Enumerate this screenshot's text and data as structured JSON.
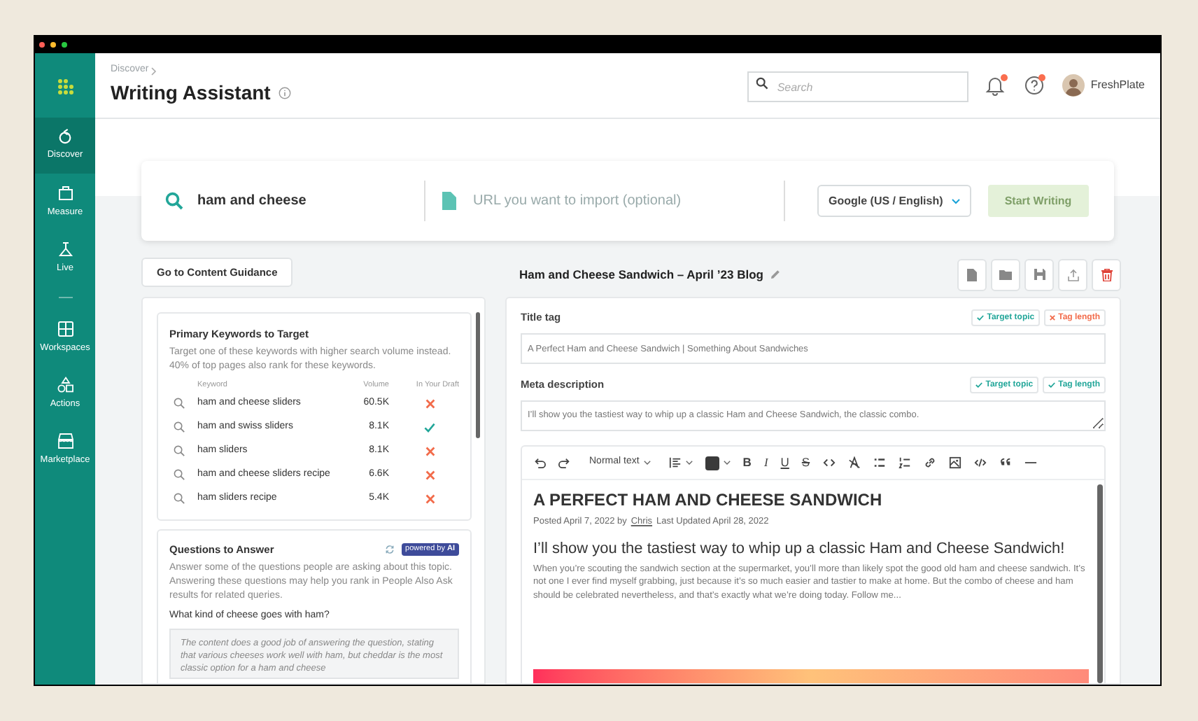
{
  "sidebar": {
    "items": [
      {
        "label": "Discover",
        "selected": true
      },
      {
        "label": "Measure",
        "selected": false
      },
      {
        "label": "Live",
        "selected": false
      },
      {
        "label": "Workspaces",
        "selected": false
      },
      {
        "label": "Actions",
        "selected": false
      },
      {
        "label": "Marketplace",
        "selected": false
      }
    ]
  },
  "header": {
    "breadcrumb": "Discover",
    "title": "Writing Assistant",
    "search": {
      "placeholder": "Search"
    },
    "notifications_unread": true,
    "help_unread": true,
    "user": "FreshPlate"
  },
  "start": {
    "keyword": "ham and cheese",
    "url_placeholder": "URL you want to import (optional)",
    "engine": "Google (US / English)",
    "button": {
      "label": "Start Writing",
      "disabled": true
    }
  },
  "guidance_button": "Go to Content Guidance",
  "keywords": {
    "title": "Primary Keywords to Target",
    "description": "Target one of these keywords with higher search volume instead. 40% of top pages also rank for these keywords.",
    "columns": [
      "Keyword",
      "Volume",
      "In Your Draft"
    ],
    "rows": [
      {
        "keyword": "ham and cheese sliders",
        "volume": "60.5K",
        "in_draft": false
      },
      {
        "keyword": "ham and swiss sliders",
        "volume": "8.1K",
        "in_draft": true
      },
      {
        "keyword": "ham sliders",
        "volume": "8.1K",
        "in_draft": false
      },
      {
        "keyword": "ham and cheese sliders recipe",
        "volume": "6.6K",
        "in_draft": false
      },
      {
        "keyword": "ham sliders recipe",
        "volume": "5.4K",
        "in_draft": false
      }
    ]
  },
  "questions": {
    "title": "Questions to Answer",
    "badge": "powered by **AI**",
    "description": "Answer some of the questions people are asking about this topic. Answering these questions may help you rank in People Also Ask results for related queries.",
    "question": "What kind of cheese goes with ham?",
    "answer": "The content does a good job of answering the question, stating that various cheeses work well with ham, but cheddar is the most classic option for a ham and cheese"
  },
  "document": {
    "title": "Ham and Cheese Sandwich – April ’23 Blog",
    "fields": [
      {
        "label": "Title tag",
        "kind": "input",
        "value": "A Perfect Ham and Cheese Sandwich | Something About Sandwiches",
        "checks": [
          {
            "label": "Target topic",
            "passed": true
          },
          {
            "label": "Tag length",
            "passed": false
          }
        ]
      },
      {
        "label": "Meta description",
        "kind": "textarea",
        "value": "I’ll show you the tastiest way to whip up a classic Ham and Cheese Sandwich, the classic combo.",
        "checks": [
          {
            "label": "Target topic",
            "passed": true
          },
          {
            "label": "Tag length",
            "passed": true
          }
        ]
      }
    ]
  },
  "editor": {
    "style": "Normal text",
    "format_buttons": [
      "B",
      "I",
      "U",
      "S"
    ],
    "heading": "A PERFECT HAM AND CHEESE SANDWICH",
    "byline": "Posted April 7, 2022 by",
    "author": "Chris",
    "updated": "Last Updated April 28, 2022",
    "subheading": "I’ll show you the tastiest way to whip up a classic Ham and Cheese Sandwich!",
    "body": "When you’re scouting the sandwich section at the supermarket, you’ll more than likely spot the good old ham and cheese sandwich. It’s not one I ever find myself grabbing, just because it’s so much easier and tastier to make at home. But the combo of cheese and ham should be celebrated nevertheless, and that’s exactly what we’re doing today. Follow me..."
  }
}
